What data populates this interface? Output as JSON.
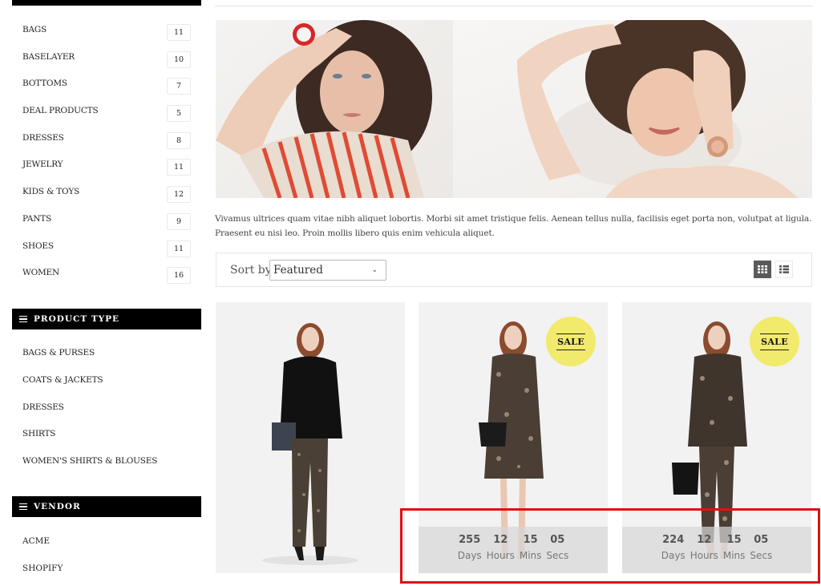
{
  "sidebar": {
    "categories": [
      {
        "label": "BAGS",
        "count": "11"
      },
      {
        "label": "BASELAYER",
        "count": "10"
      },
      {
        "label": "BOTTOMS",
        "count": "7"
      },
      {
        "label": "DEAL PRODUCTS",
        "count": "5"
      },
      {
        "label": "DRESSES",
        "count": "8"
      },
      {
        "label": "JEWELRY",
        "count": "11"
      },
      {
        "label": "KIDS & TOYS",
        "count": "12"
      },
      {
        "label": "PANTS",
        "count": "9"
      },
      {
        "label": "SHOES",
        "count": "11"
      },
      {
        "label": "WOMEN",
        "count": "16"
      }
    ],
    "product_type": {
      "title": "PRODUCT TYPE",
      "icon": "menu-icon",
      "items": [
        "BAGS & PURSES",
        "COATS & JACKETS",
        "DRESSES",
        "SHIRTS",
        "WOMEN'S SHIRTS & BLOUSES"
      ]
    },
    "vendor": {
      "title": "VENDOR",
      "icon": "menu-icon",
      "items": [
        "ACME",
        "SHOPIFY"
      ]
    }
  },
  "main": {
    "banner_alt": "Collection banner: women wearing watches",
    "description": "Vivamus ultrices quam vitae nibh aliquet lobortis. Morbi sit amet tristique felis. Aenean tellus nulla, facilisis eget porta non, volutpat at ligula. Praesent eu nisi leo. Proin mollis libero quis enim vehicula aliquet.",
    "toolbar": {
      "sort_label": "Sort by",
      "sort_value": "Featured",
      "grid_view_icon": "grid-icon",
      "list_view_icon": "list-icon",
      "active_view": "grid"
    },
    "products": [
      {
        "badge": null,
        "countdown": null
      },
      {
        "badge": "SALE",
        "countdown": {
          "days": "255",
          "hours": "12",
          "mins": "15",
          "secs": "05",
          "labels": {
            "days": "Days",
            "hours": "Hours",
            "mins": "Mins",
            "secs": "Secs"
          }
        }
      },
      {
        "badge": "SALE",
        "countdown": {
          "days": "224",
          "hours": "12",
          "mins": "15",
          "secs": "05",
          "labels": {
            "days": "Days",
            "hours": "Hours",
            "mins": "Mins",
            "secs": "Secs"
          }
        }
      }
    ]
  },
  "colors": {
    "sale_badge": "#f1ea6c",
    "header_bg": "#000000",
    "highlight": "#e01010",
    "active_view": "#5a5a5a"
  }
}
